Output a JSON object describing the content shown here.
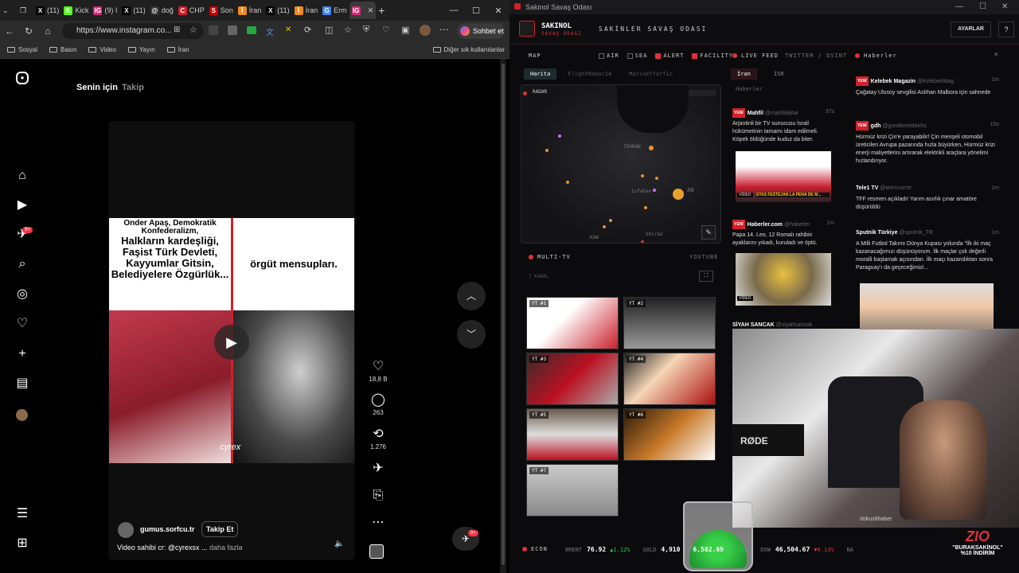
{
  "edge": {
    "tabs": [
      {
        "icon": "X",
        "label": "(11)"
      },
      {
        "icon": "K",
        "label": "Kick"
      },
      {
        "icon": "IG",
        "label": "(9) I"
      },
      {
        "icon": "X",
        "label": "(11)"
      },
      {
        "icon": "@",
        "label": "doğ"
      },
      {
        "icon": "C",
        "label": "CHP"
      },
      {
        "icon": "S",
        "label": "Son"
      },
      {
        "icon": "İ",
        "label": "İran"
      },
      {
        "icon": "X",
        "label": "(11)"
      },
      {
        "icon": "İ",
        "label": "İran"
      },
      {
        "icon": "G",
        "label": "Erm"
      },
      {
        "icon": "IG",
        "label": ""
      }
    ],
    "url": "https://www.instagram.co...",
    "copilot_label": "Sohbet et",
    "bookmarks": [
      "Sosyal",
      "Basın",
      "Video",
      "Yayın",
      "İran"
    ],
    "bookmarks_other": "Diğer sık kullanılanlar"
  },
  "instagram": {
    "feed_tabs": [
      "Senin için",
      "Takip"
    ],
    "notif_badge": "9+",
    "overlay_left": "Halkların kardeşliği, Faşist Türk Devleti, Kayyumlar Gitsin, Belediyelere Özgürlük...",
    "overlay_left_top": "Onder Apaş, Demokratik Konfederalizm,",
    "overlay_right": "örgüt mensupları.",
    "watermark": "cyrex",
    "likes": "18,8 B",
    "comments": "263",
    "reposts": "1.276",
    "username": "gumus.sorfcu.tr",
    "follow": "Takip Et",
    "caption": "Video sahibi cr: @cyrexsx ...",
    "more": "daha fazla",
    "dm_badge": "9+"
  },
  "sakinol": {
    "window_title": "Sakinol Savaş Odası",
    "logo": "SAKINOL",
    "logo_sub": "SAVAŞ ODASI",
    "room_title": "SAKİNLER SAVAŞ ODASI",
    "settings": "AYARLAR",
    "map_label": "MAP",
    "map_filters": [
      "AIR",
      "SEA",
      "ALERT",
      "FACILITY"
    ],
    "map_tabs": [
      "Harita",
      "FlightRadar24",
      "MarineTraffic"
    ],
    "radar": "RADAR",
    "map_places": [
      "TEHRAN",
      "Isfahan",
      "KUW",
      "AN",
      "Shiraz"
    ],
    "multitv": "MULTI-TV",
    "youtube": "YOUTUBE",
    "kanal": "7 KANAL",
    "tv": [
      "YT #1",
      "YT #2",
      "YT #3",
      "YT #4",
      "YT #5",
      "YT #6",
      "YT #7"
    ],
    "live_feed": "LIVE FEED",
    "twitter": "TWITTER / OSINT",
    "feed_tabs": [
      "İran",
      "İSR"
    ],
    "feed_sub": "Haberler",
    "feed": [
      {
        "badge": "YENİ",
        "source": "Mahfil",
        "handle": "@mahfildijital",
        "time": "37s",
        "text": "Arjantinli bir TV sunucusu İsrail hükümetinin tamamı idam edilmeli. Köpek öldüğünde kuduz da biter.",
        "caption": "STAS FESTEJAN LA PENA DE M..."
      },
      {
        "badge": "YENİ",
        "source": "Haberler.com",
        "handle": "@haberler",
        "time": "1m",
        "text": "Papa 14. Leo, 12 Romalı rahibin ayaklarını yıkadı, kuruladı ve öptü."
      },
      {
        "source": "SİYAH SANCAK",
        "handle": "@siyahsancak",
        "time": "",
        "text": ""
      }
    ],
    "video_tag": "VİDEO",
    "news_label": "Haberler",
    "news": [
      {
        "badge": "YENİ",
        "source": "Kelebek Magazin",
        "handle": "@KelebekMag",
        "time": "1m",
        "text": "Çağatay Ulusoy sevgilisi Aslıhan Malbora için sahnede"
      },
      {
        "badge": "YENİ",
        "source": "gdh",
        "handle": "@gundemedairhs",
        "time": "15s",
        "text": "Hürmüz krizi Çin'e yarayabilir! Çin menşeli otomobil üreticileri Avrupa pazarında hızla büyürken, Hürmüz krizi enerji maliyetlerini artırarak elektrikli araçlara yönelimi hızlandırıyor."
      },
      {
        "source": "Tele1 TV",
        "handle": "@tele1comtr",
        "time": "1m",
        "text": "TFF resmen açıkladı! Yarım asırlık çınar amatöre düşürüldü"
      },
      {
        "source": "Sputnik Türkiye",
        "handle": "@sputnik_TR",
        "time": "1m",
        "text": "A Milli Futbol Takımı Dünya Kupası yolunda \"İlk iki maç kazanacağımızı düşünüyorum. İlk maçlar çok değerli moralli başlamak açısından. İlk maçı kazandıktan sonra Paraguay'ı da geçeceğimizi..."
      }
    ],
    "news_footer": "dokuz8haber",
    "econ": "ECON",
    "ticker": [
      {
        "name": "BRENT",
        "value": "76.92",
        "chg": "1.12%",
        "dir": "up"
      },
      {
        "name": "GOLD",
        "value": "4,910",
        "chg": "",
        "dir": ""
      },
      {
        "name": "",
        "value": "6,582.69",
        "chg": "0.11%",
        "dir": "up"
      },
      {
        "name": "DOW",
        "value": "46,504.67",
        "chg": "0.13%",
        "dir": "down"
      },
      {
        "name": "NA",
        "value": "",
        "chg": "",
        "dir": ""
      }
    ],
    "promo_logo": "ZIO",
    "promo_code": "\"BURAKSAKİNOL\"",
    "promo_discount": "%10 İNDİRİM",
    "mic_brand": "RØDE"
  }
}
